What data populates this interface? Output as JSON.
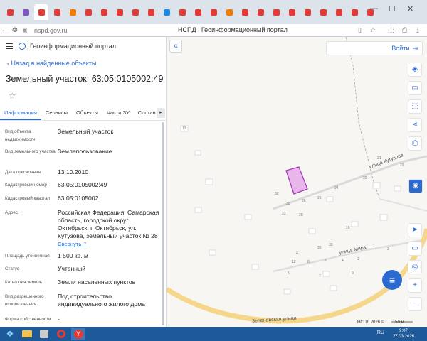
{
  "browser": {
    "url": "nspd.gov.ru",
    "page_title": "НСПД | Геоинформационный портал",
    "win_controls": [
      "—",
      "☐",
      "✕"
    ]
  },
  "tabs_colors": [
    "#e53935",
    "#7e57c2",
    "#e53935",
    "#e53935",
    "#f57c00",
    "#e53935",
    "#e53935",
    "#e53935",
    "#e53935",
    "#e53935",
    "#1e88e5",
    "#e53935",
    "#e53935",
    "#e53935",
    "#f57c00",
    "#e53935",
    "#e53935",
    "#e53935",
    "#e53935",
    "#e53935",
    "#e53935",
    "#e53935",
    "#e53935",
    "#e53935"
  ],
  "panel": {
    "portal_name": "Геоинформационный портал",
    "back_link": "Назад в найденные объекты",
    "title": "Земельный участок: 63:05:0105002:49",
    "tabs": [
      "Информация",
      "Сервисы",
      "Объекты",
      "Части ЗУ",
      "Состав"
    ],
    "tab_more": "▸",
    "rows": [
      {
        "label": "Вид объекта недвижимости",
        "value": "Земельный участок"
      },
      {
        "label": "Вид земельного участка",
        "value": "Землепользование"
      },
      {
        "label": "Дата присвоения",
        "value": "13.10.2010"
      },
      {
        "label": "Кадастровый номер",
        "value": "63:05:0105002:49"
      },
      {
        "label": "Кадастровый квартал",
        "value": "63:05:0105002"
      },
      {
        "label": "Адрес",
        "value": "Российская Федерация, Самарская область, городской округ Октябрьск, г. Октябрьск, ул. Кутузова, земельный участок № 28"
      },
      {
        "label": "Площадь уточненная",
        "value": "1 500 кв. м"
      },
      {
        "label": "Статус",
        "value": "Учтенный"
      },
      {
        "label": "Категория земель",
        "value": "Земли населенных пунктов"
      },
      {
        "label": "Вид разрешенного использования",
        "value": "Под строительство индивидуального жилого дома"
      },
      {
        "label": "Форма собственности",
        "value": "-"
      }
    ],
    "collapse_link": "Свернуть"
  },
  "map": {
    "collapse_btn": "«",
    "login_label": "Войти",
    "streets": [
      "улица Кутузова",
      "улица Мира",
      "Зеленовская улица"
    ],
    "numbers": [
      "13",
      "32",
      "30",
      "28",
      "26",
      "24",
      "22",
      "23",
      "20",
      "21",
      "22",
      "16",
      "4",
      "33",
      "35",
      "5",
      "7",
      "9",
      "12",
      "8",
      "6",
      "4",
      "2",
      "1",
      "3"
    ],
    "attribution": "НСПД 2026",
    "scale_label": "50 м"
  },
  "taskbar": {
    "lang": "RU",
    "time": "9:07",
    "date": "27.03.2026"
  }
}
